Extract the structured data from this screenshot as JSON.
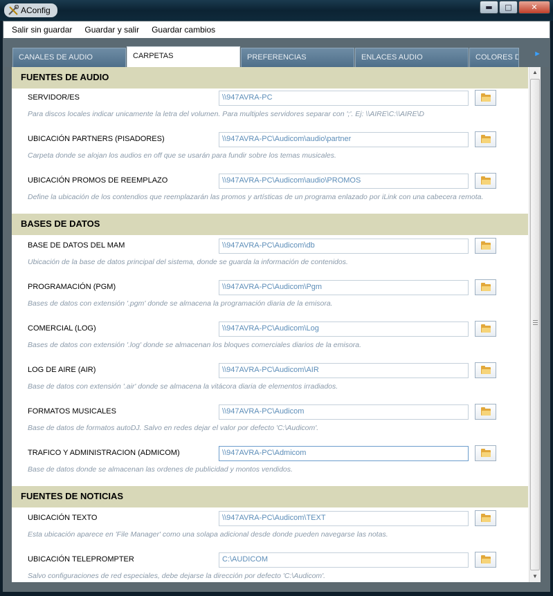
{
  "window": {
    "title": "AConfig"
  },
  "menu": [
    "Salir sin guardar",
    "Guardar y salir",
    "Guardar cambios"
  ],
  "tabs": [
    "CANALES DE AUDIO",
    "CARPETAS",
    "PREFERENCIAS",
    "ENLACES AUDIO",
    "COLORES D"
  ],
  "tab_arrow": "►",
  "window_buttons": {
    "minimize": "▬",
    "maximize": "□",
    "close": "✕"
  },
  "sections": [
    {
      "title": "FUENTES DE AUDIO",
      "fields": [
        {
          "label": "SERVIDOR/ES",
          "value": "\\\\947AVRA-PC",
          "hint": "Para discos locales indicar unicamente la letra del volumen. Para multiples servidores separar con ';'. Ej: \\\\AIRE\\C:\\\\AIRE\\D"
        },
        {
          "label": "UBICACIÓN PARTNERS (PISADORES)",
          "value": "\\\\947AVRA-PC\\Audicom\\audio\\partner",
          "hint": "Carpeta donde se alojan los audios en off que se usarán para fundir sobre los temas musicales."
        },
        {
          "label": "UBICACIÓN PROMOS DE REEMPLAZO",
          "value": "\\\\947AVRA-PC\\Audicom\\audio\\PROMOS",
          "hint": "Define la ubicación de los contendios que reemplazarán las promos y artísticas de un programa enlazado por iLink con una cabecera remota."
        }
      ]
    },
    {
      "title": "BASES DE DATOS",
      "fields": [
        {
          "label": "BASE DE DATOS DEL MAM",
          "value": "\\\\947AVRA-PC\\Audicom\\db",
          "hint": "Ubicación de la base de datos principal del sistema, donde se guarda la información de contenidos."
        },
        {
          "label": "PROGRAMACIÓN (PGM)",
          "value": "\\\\947AVRA-PC\\Audicom\\Pgm",
          "hint": "Bases de datos con extensión '.pgm' donde se almacena la programación diaria de la emisora."
        },
        {
          "label": "COMERCIAL (LOG)",
          "value": "\\\\947AVRA-PC\\Audicom\\Log",
          "hint": "Bases de datos con extensión '.log' donde se almacenan los bloques comerciales diarios de la emisora."
        },
        {
          "label": "LOG DE AIRE (AIR)",
          "value": "\\\\947AVRA-PC\\Audicom\\AIR",
          "hint": "Base de datos con extensión '.air' donde se almacena la vitácora diaria de elementos irradiados."
        },
        {
          "label": "FORMATOS MUSICALES",
          "value": "\\\\947AVRA-PC\\Audicom",
          "hint": "Base de datos de formatos autoDJ. Salvo en redes dejar el valor por defecto 'C:\\Audicom'."
        },
        {
          "label": "TRAFICO Y ADMINISTRACION (ADMICOM)",
          "value": "\\\\947AVRA-PC\\Admicom",
          "hint": "Base de datos donde se almacenan las ordenes de publicidad y montos vendidos."
        }
      ]
    },
    {
      "title": "FUENTES DE NOTICIAS",
      "fields": [
        {
          "label": "UBICACIÓN TEXTO",
          "value": "\\\\947AVRA-PC\\Audicom\\TEXT",
          "hint": "Esta ubicación aparece en 'File Manager' como una solapa adicional desde donde pueden navegarse las notas."
        },
        {
          "label": "UBICACIÓN TELEPROMPTER",
          "value": "C:\\AUDICOM",
          "hint": "Salvo configuraciones de red especiales, debe dejarse la dirección por defecto 'C:\\Audicom'."
        }
      ]
    }
  ]
}
